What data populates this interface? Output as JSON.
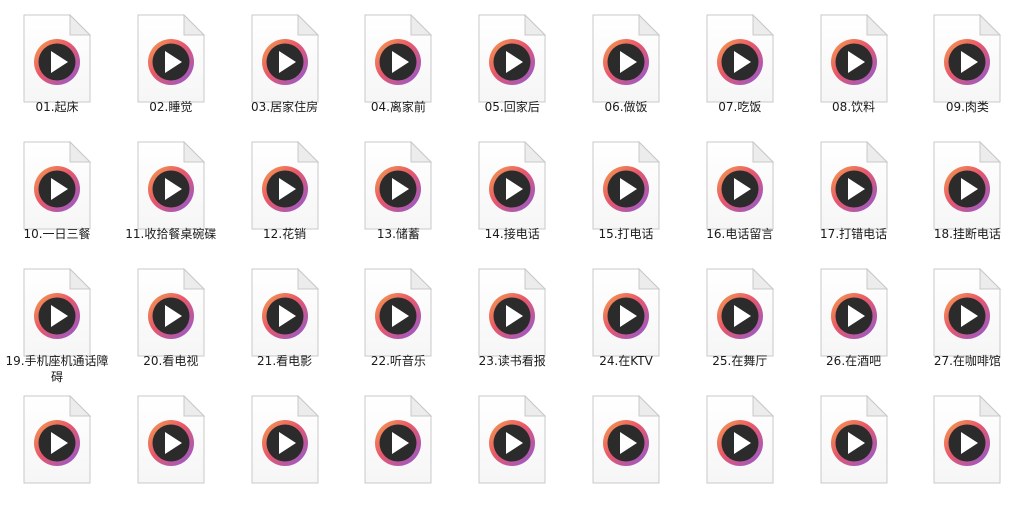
{
  "window": {
    "view": "large-icons",
    "file_icon": "video-file-icon",
    "play_icon": "play-icon",
    "colors": {
      "ring_orange": "#f08a3c",
      "ring_pink": "#e0507a",
      "ring_purple": "#8e5bd6",
      "disc": "#2b2b2b",
      "page_fold": "#d6d6d6"
    }
  },
  "files": [
    {
      "name": "01.起床"
    },
    {
      "name": "02.睡觉"
    },
    {
      "name": "03.居家住房"
    },
    {
      "name": "04.离家前"
    },
    {
      "name": "05.回家后"
    },
    {
      "name": "06.做饭"
    },
    {
      "name": "07.吃饭"
    },
    {
      "name": "08.饮料"
    },
    {
      "name": "09.肉类"
    },
    {
      "name": "10.一日三餐"
    },
    {
      "name": "11.收拾餐桌碗碟"
    },
    {
      "name": "12.花销"
    },
    {
      "name": "13.储蓄"
    },
    {
      "name": "14.接电话"
    },
    {
      "name": "15.打电话"
    },
    {
      "name": "16.电话留言"
    },
    {
      "name": "17.打错电话"
    },
    {
      "name": "18.挂断电话"
    },
    {
      "name": "19.手机座机通话障碍"
    },
    {
      "name": "20.看电视"
    },
    {
      "name": "21.看电影"
    },
    {
      "name": "22.听音乐"
    },
    {
      "name": "23.读书看报"
    },
    {
      "name": "24.在KTV"
    },
    {
      "name": "25.在舞厅"
    },
    {
      "name": "26.在酒吧"
    },
    {
      "name": "27.在咖啡馆"
    },
    {
      "name": ""
    },
    {
      "name": ""
    },
    {
      "name": ""
    },
    {
      "name": ""
    },
    {
      "name": ""
    },
    {
      "name": ""
    },
    {
      "name": ""
    },
    {
      "name": ""
    },
    {
      "name": ""
    }
  ]
}
